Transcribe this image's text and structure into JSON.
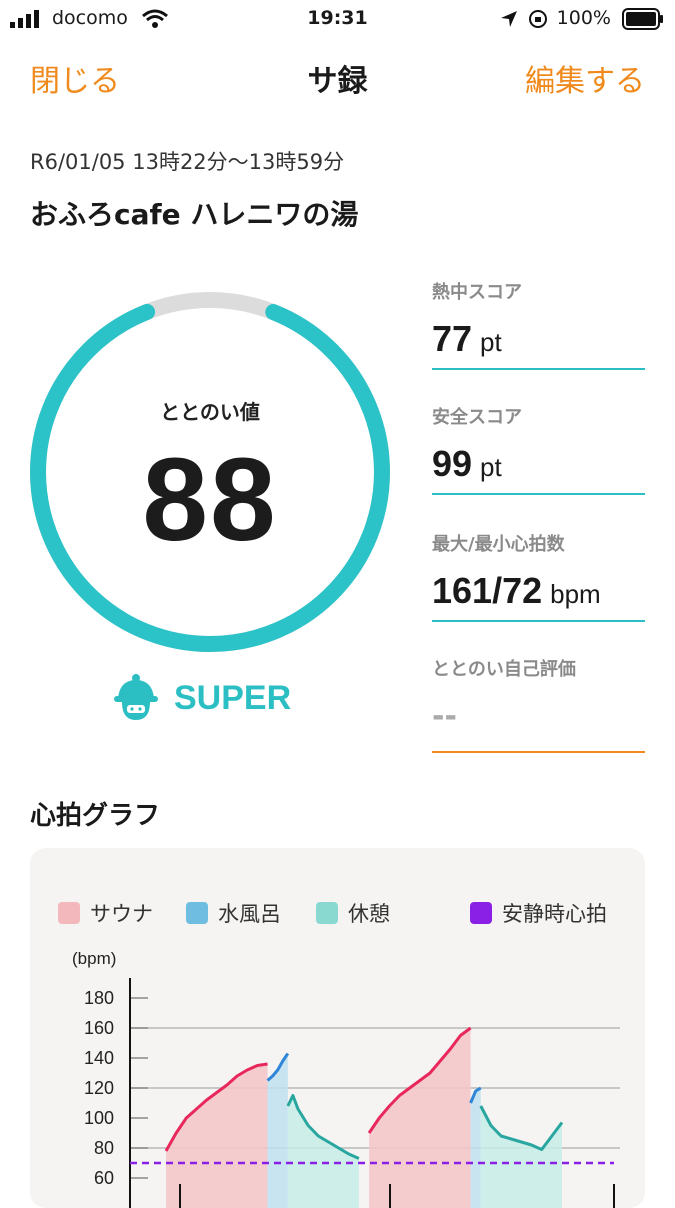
{
  "status_bar": {
    "carrier": "docomo",
    "time": "19:31",
    "battery": "100%"
  },
  "nav": {
    "close": "閉じる",
    "title": "サ録",
    "edit": "編集する"
  },
  "session": {
    "datetime": "R6/01/05 13時22分～13時59分",
    "place": "おふろcafe ハレニワの湯"
  },
  "gauge": {
    "label": "ととのい値",
    "value": "88",
    "rank": "SUPER",
    "fill_fraction": 0.88
  },
  "stats": [
    {
      "label": "熱中スコア",
      "value": "77",
      "unit": "pt"
    },
    {
      "label": "安全スコア",
      "value": "99",
      "unit": "pt"
    },
    {
      "label": "最大/最小心拍数",
      "value": "161/72",
      "unit": "bpm"
    },
    {
      "label": "ととのい自己評価",
      "value": "--",
      "unit": ""
    }
  ],
  "graph": {
    "title": "心拍グラフ",
    "legend": [
      {
        "label": "サウナ",
        "color": "#f2b8bc"
      },
      {
        "label": "水風呂",
        "color": "#6fbde0"
      },
      {
        "label": "休憩",
        "color": "#8ad9d0"
      },
      {
        "label": "安静時心拍",
        "color": "#8a1fe6"
      }
    ],
    "y_unit": "(bpm)",
    "y_ticks": [
      "180",
      "160",
      "140",
      "120",
      "100",
      "80",
      "60"
    ]
  },
  "chart_data": {
    "type": "line",
    "ylabel": "(bpm)",
    "ylim": [
      50,
      185
    ],
    "resting_hr": 70,
    "series": [
      {
        "name": "サウナ",
        "color": "#e8285c",
        "points": [
          [
            0,
            78
          ],
          [
            2,
            90
          ],
          [
            4,
            100
          ],
          [
            6,
            106
          ],
          [
            8,
            112
          ],
          [
            10,
            117
          ],
          [
            12,
            122
          ],
          [
            14,
            128
          ],
          [
            16,
            132
          ],
          [
            18,
            135
          ],
          [
            20,
            136
          ]
        ]
      },
      {
        "name": "水風呂",
        "color": "#2f86d8",
        "points": [
          [
            20,
            125
          ],
          [
            21,
            128
          ],
          [
            22,
            132
          ],
          [
            23,
            138
          ],
          [
            24,
            143
          ]
        ]
      },
      {
        "name": "休憩",
        "color": "#2aa6a0",
        "points": [
          [
            24,
            108
          ],
          [
            25,
            115
          ],
          [
            26,
            106
          ],
          [
            28,
            95
          ],
          [
            30,
            88
          ],
          [
            32,
            84
          ],
          [
            34,
            80
          ],
          [
            36,
            76
          ],
          [
            38,
            73
          ]
        ]
      },
      {
        "name": "サウナ",
        "color": "#e8285c",
        "points": [
          [
            40,
            90
          ],
          [
            42,
            100
          ],
          [
            44,
            108
          ],
          [
            46,
            115
          ],
          [
            48,
            120
          ],
          [
            50,
            125
          ],
          [
            52,
            130
          ],
          [
            54,
            138
          ],
          [
            56,
            146
          ],
          [
            58,
            155
          ],
          [
            60,
            160
          ]
        ]
      },
      {
        "name": "水風呂",
        "color": "#2f86d8",
        "points": [
          [
            60,
            110
          ],
          [
            61,
            118
          ],
          [
            62,
            120
          ]
        ]
      },
      {
        "name": "休憩",
        "color": "#2aa6a0",
        "points": [
          [
            62,
            108
          ],
          [
            64,
            95
          ],
          [
            66,
            88
          ],
          [
            68,
            86
          ],
          [
            70,
            84
          ],
          [
            72,
            82
          ],
          [
            74,
            79
          ],
          [
            76,
            88
          ],
          [
            78,
            97
          ]
        ]
      }
    ]
  }
}
